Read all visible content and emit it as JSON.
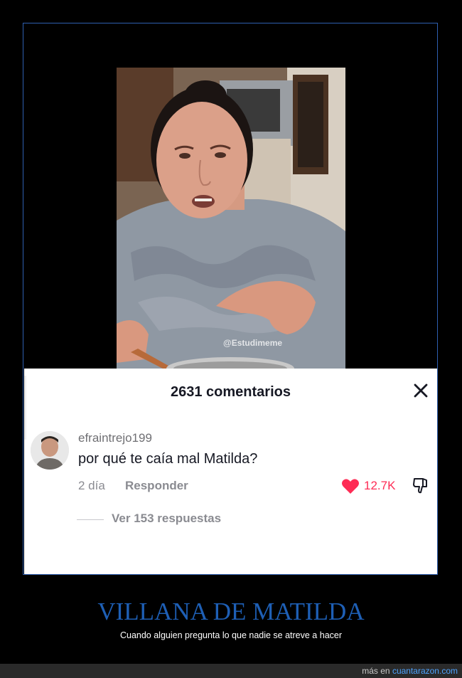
{
  "video": {
    "watermark": "@Estudimeme"
  },
  "comments_panel": {
    "title": "2631 comentarios",
    "close_icon": "close-icon",
    "comment": {
      "username": "efraintrejo199",
      "text": "por qué te caía mal Matilda?",
      "date": "2 día",
      "reply_label": "Responder",
      "like_count": "12.7K",
      "like_color": "#fe2c55",
      "view_replies": "Ver 153 respuestas"
    }
  },
  "caption": {
    "title": "VILLANA DE MATILDA",
    "subtitle": "Cuando alguien pregunta lo que nadie se atreve a hacer",
    "title_color": "#1e5fb5"
  },
  "footer": {
    "prefix": "más en",
    "link": "cuantarazon.com"
  }
}
